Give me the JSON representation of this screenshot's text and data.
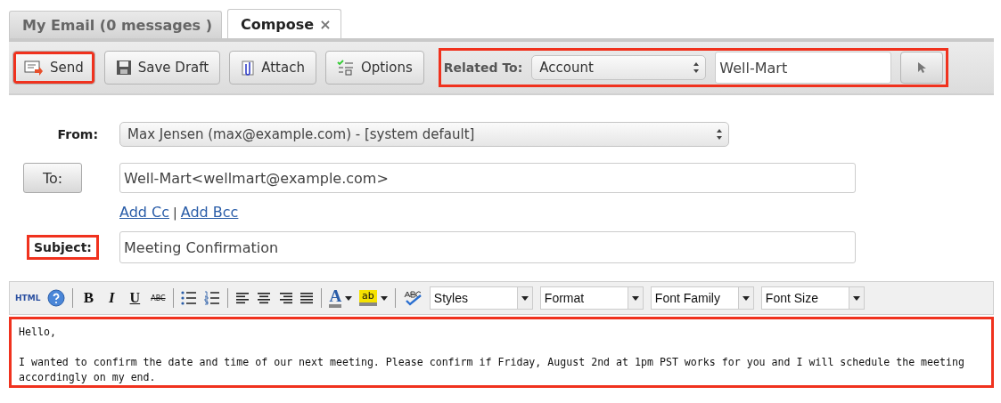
{
  "tabs": [
    {
      "label": "My Email (0 messages )",
      "selected": false,
      "closable": false
    },
    {
      "label": "Compose",
      "selected": true,
      "closable": true,
      "close": "×"
    }
  ],
  "toolbar": {
    "buttons": [
      {
        "label": "Send",
        "kind": "send",
        "highlighted": true
      },
      {
        "label": "Save Draft",
        "kind": "save",
        "highlighted": false
      },
      {
        "label": "Attach",
        "kind": "attach",
        "highlighted": false
      },
      {
        "label": "Options",
        "kind": "options",
        "highlighted": false
      }
    ],
    "related": {
      "label": "Related To:",
      "type": "Account",
      "value": "Well-Mart",
      "highlighted": true
    }
  },
  "form": {
    "from": {
      "label": "From:",
      "value": "Max Jensen (max@example.com) - [system default]"
    },
    "to": {
      "label": "To:",
      "value": "Well-Mart<wellmart@example.com>"
    },
    "links": [
      "Add Cc",
      "Add Bcc"
    ],
    "link_separator": "|",
    "subject": {
      "label": "Subject:",
      "value": "Meeting Confirmation",
      "highlighted": true
    }
  },
  "editor": {
    "tools": [
      {
        "kind": "html",
        "text": "HTML"
      },
      {
        "kind": "help"
      },
      {
        "kind": "sep"
      },
      {
        "kind": "bold",
        "text": "B"
      },
      {
        "kind": "italic",
        "text": "I"
      },
      {
        "kind": "underline",
        "text": "U"
      },
      {
        "kind": "strike",
        "text": "ABC"
      },
      {
        "kind": "sep"
      },
      {
        "kind": "bullets"
      },
      {
        "kind": "numbers"
      },
      {
        "kind": "sep"
      },
      {
        "kind": "align-left"
      },
      {
        "kind": "align-center"
      },
      {
        "kind": "align-right"
      },
      {
        "kind": "justify"
      },
      {
        "kind": "sep"
      },
      {
        "kind": "font-color",
        "text": "A"
      },
      {
        "kind": "highlight",
        "text": "ab"
      },
      {
        "kind": "sep"
      },
      {
        "kind": "spellcheck"
      }
    ],
    "selects": [
      "Styles",
      "Format",
      "Font Family",
      "Font Size"
    ],
    "highlighted": true,
    "paragraphs": [
      "Hello,",
      "I wanted to confirm the date and time of our next meeting. Please confirm if Friday, August 2nd at 1pm PST works for you and I will schedule the meeting accordingly on my end."
    ]
  }
}
